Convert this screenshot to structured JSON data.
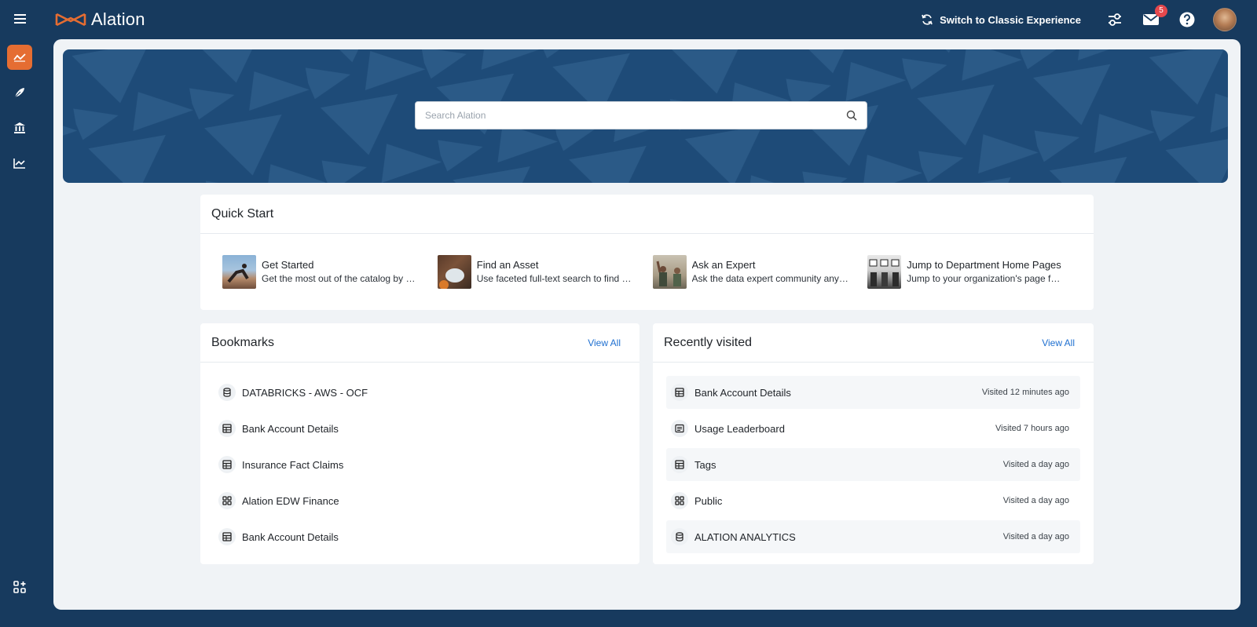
{
  "app": {
    "name": "Alation"
  },
  "header": {
    "switch_label": "Switch to Classic Experience",
    "notifications_count": "5",
    "icons": [
      "hamburger-icon",
      "filter-settings-icon",
      "mail-icon",
      "help-icon"
    ]
  },
  "rail": {
    "items": [
      {
        "icon": "home-trend-icon",
        "active": true
      },
      {
        "icon": "compose-icon"
      },
      {
        "icon": "catalog-building-icon"
      },
      {
        "icon": "analytics-icon"
      },
      {
        "icon": "apps-grid-icon"
      }
    ]
  },
  "search": {
    "placeholder": "Search Alation"
  },
  "quick_start": {
    "title": "Quick Start",
    "items": [
      {
        "title": "Get Started",
        "desc": "Get the most out of the catalog by …"
      },
      {
        "title": "Find an Asset",
        "desc": "Use faceted full-text search to find …"
      },
      {
        "title": "Ask an Expert",
        "desc": "Ask the data expert community any…"
      },
      {
        "title": "Jump to Department Home Pages",
        "desc": "Jump to your organization's page fo…"
      }
    ]
  },
  "bookmarks": {
    "title": "Bookmarks",
    "view_all": "View All",
    "items": [
      {
        "label": "DATABRICKS - AWS - OCF",
        "icon": "database-icon"
      },
      {
        "label": "Bank Account Details",
        "icon": "table-icon"
      },
      {
        "label": "Insurance Fact Claims",
        "icon": "table-icon"
      },
      {
        "label": "Alation EDW Finance",
        "icon": "schema-icon"
      },
      {
        "label": "Bank Account Details",
        "icon": "table-icon"
      }
    ]
  },
  "recent": {
    "title": "Recently visited",
    "view_all": "View All",
    "items": [
      {
        "label": "Bank Account Details",
        "meta": "Visited 12 minutes ago",
        "icon": "table-icon"
      },
      {
        "label": "Usage Leaderboard",
        "meta": "Visited 7 hours ago",
        "icon": "article-icon"
      },
      {
        "label": "Tags",
        "meta": "Visited a day ago",
        "icon": "table-icon"
      },
      {
        "label": "Public",
        "meta": "Visited a day ago",
        "icon": "schema-icon"
      },
      {
        "label": "ALATION ANALYTICS",
        "meta": "Visited a day ago",
        "icon": "database-icon"
      }
    ]
  },
  "colors": {
    "navy": "#173a5e",
    "accent": "#e56d32",
    "link": "#1e6fd0",
    "panel": "#f0f3f6"
  }
}
